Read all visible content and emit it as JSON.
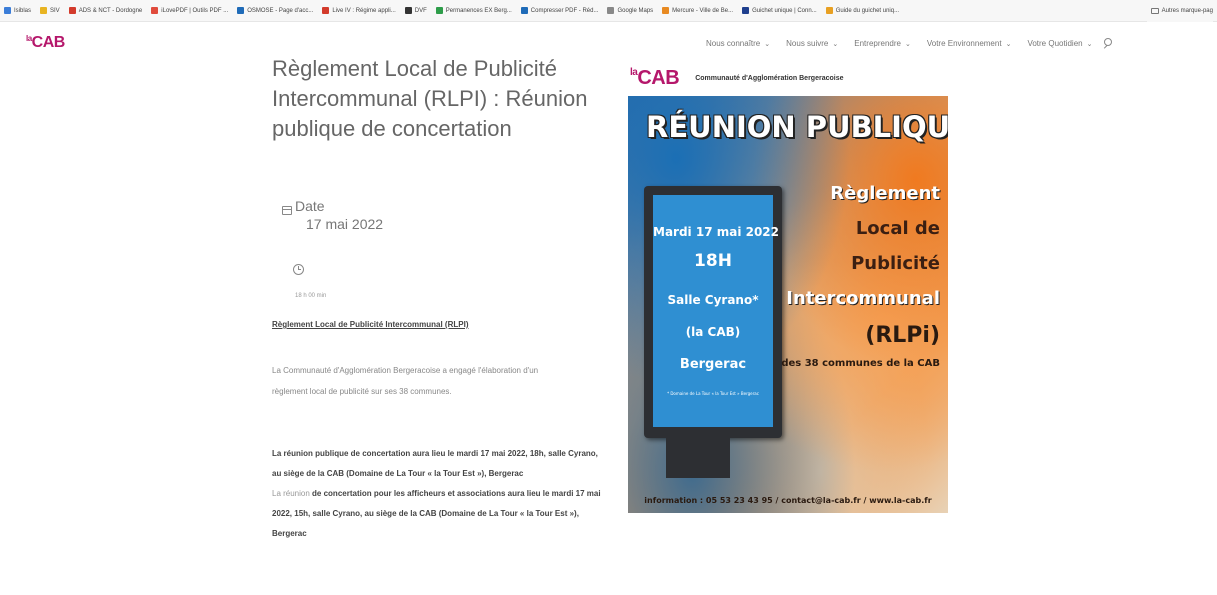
{
  "bookmarks": [
    {
      "label": "Isiblas",
      "color": "#3b7dd8"
    },
    {
      "label": "SIV",
      "color": "#e8b422"
    },
    {
      "label": "ADS & NCT - Dordogne",
      "color": "#d33b2c"
    },
    {
      "label": "iLovePDF | Outils PDF ...",
      "color": "#e04b3c"
    },
    {
      "label": "OSMOSE - Page d'acc...",
      "color": "#1f6bb8"
    },
    {
      "label": "Live IV : Régime appli...",
      "color": "#d33b2c"
    },
    {
      "label": "DVF",
      "color": "#333333"
    },
    {
      "label": "Permanences EX Berg...",
      "color": "#2e9d4a"
    },
    {
      "label": "Compresser PDF - Réd...",
      "color": "#1f6bb8"
    },
    {
      "label": "Google Maps",
      "color": "#888888"
    },
    {
      "label": "Mercure - Ville de Be...",
      "color": "#e88a22"
    },
    {
      "label": "Guichet unique | Conn...",
      "color": "#1f3f8e"
    },
    {
      "label": "Guide du guichet uniq...",
      "color": "#e8a022"
    }
  ],
  "bookmarks_folder": "Autres marque-pag",
  "header": {
    "logo_prefix": "la",
    "logo": "CAB",
    "nav": [
      {
        "label": "Nous connaître"
      },
      {
        "label": "Nous suivre"
      },
      {
        "label": "Entreprendre"
      },
      {
        "label": "Votre Environnement"
      },
      {
        "label": "Votre Quotidien"
      }
    ],
    "chevron": "⌄"
  },
  "article": {
    "title": "Règlement Local de Publicité Intercommunal (RLPI) : Réunion publique de concertation",
    "date_label": "Date",
    "date_value": "17 mai 2022",
    "time_value": "18 h 00 min",
    "heading": "Règlement Local de Publicité Intercommunal (RLPI)",
    "intro": "La Communauté d'Agglomération Bergeracoise a engagé l'élaboration d'un règlement local de publicité sur ses 38 communes.",
    "meeting_bold": "La réunion publique de concertation aura lieu le mardi 17 mai 2022, 18h, salle Cyrano, au siège de la CAB (Domaine de La Tour « la Tour Est »), Bergerac",
    "meeting2_light": "La réunion",
    "meeting2_bold": " de concertation pour les afficheurs et associations aura lieu le mardi 17 mai 2022, 15h, salle Cyrano, au siège de la CAB (Domaine de La Tour « la Tour Est »), Bergerac"
  },
  "poster": {
    "logo_prefix": "la",
    "logo": "CAB",
    "org": "Communauté d'Agglomération Bergeracoise",
    "title": "RÉUNION PUBLIQUE",
    "bb_date": "Mardi 17 mai 2022",
    "bb_time": "18H",
    "bb_place1": "Salle Cyrano*",
    "bb_place2": "(la CAB)",
    "bb_city": "Bergerac",
    "bb_addr": "* Domaine de La Tour « la Tour Est » Bergerac",
    "rlp_1": "Règlement",
    "rlp_2": "Local de",
    "rlp_3": "Publicité",
    "rlp_4": "Intercommunal",
    "rlp_code": "(RLPi)",
    "rlp_sub": "des 38 communes de la CAB",
    "footer": "information : 05 53 23 43 95 / contact@la-cab.fr / www.la-cab.fr"
  }
}
